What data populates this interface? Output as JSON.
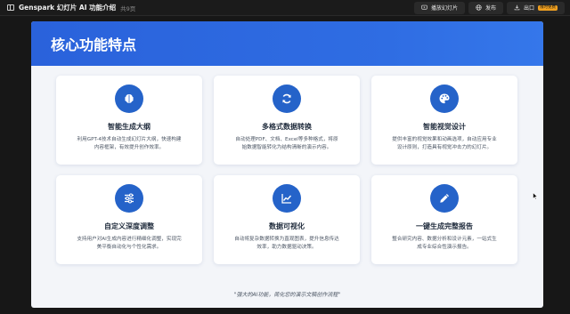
{
  "topbar": {
    "title": "Genspark 幻灯片 AI 功能介绍",
    "page_count": "共9页",
    "play_label": "播放幻灯片",
    "publish_label": "发布",
    "export_label": "出口",
    "export_badge": "限时免费"
  },
  "slide": {
    "title": "核心功能特点",
    "cards": [
      {
        "icon": "brain-icon",
        "title": "智能生成大纲",
        "desc": "利用GPT-4技术自动生成幻灯片大纲，快速构建\n内容框架，有效提升创作效率。"
      },
      {
        "icon": "sync-icon",
        "title": "多格式数据转换",
        "desc": "自动处理PDF、文档、Excel等多种格式，将原\n始数据智能转化为结构清晰的演示内容。"
      },
      {
        "icon": "palette-icon",
        "title": "智能视觉设计",
        "desc": "提供丰富的视觉效果和动画选项，自动应用专业\n设计原则，打造具有视觉冲击力的幻灯片。"
      },
      {
        "icon": "sliders-icon",
        "title": "自定义深度调整",
        "desc": "支持用户对AI生成内容进行精细化调整，实现完\n美平衡自动化与个性化需求。"
      },
      {
        "icon": "chart-line-icon",
        "title": "数据可视化",
        "desc": "自动将复杂数据转换为直观图表，提升信息传达\n效率，助力数据驱动决策。"
      },
      {
        "icon": "pen-icon",
        "title": "一键生成完整报告",
        "desc": "整合研究内容、数据分析和设计元素，一站式生\n成专业综合性演示报告。"
      }
    ],
    "footer": "\"强大的AI功能，简化您的演示文稿创作流程\""
  },
  "colors": {
    "header_blue": "#2f6de3",
    "icon_blue": "#2563c9",
    "badge": "#f0a020"
  }
}
